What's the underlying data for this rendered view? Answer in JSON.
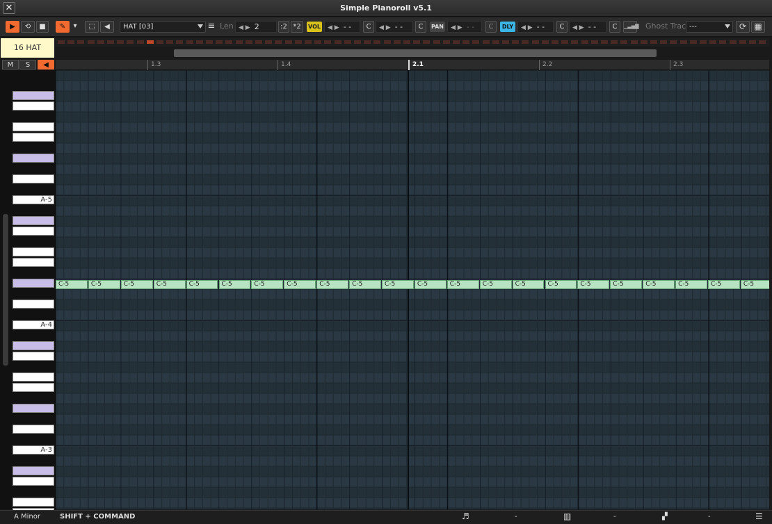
{
  "window": {
    "title": "Simple Pianoroll v5.1",
    "close_icon": "✕"
  },
  "toolbar": {
    "play_icon": "▶",
    "loop_icon": "⟲",
    "stop_icon": "■",
    "pencil_icon": "✎",
    "pencil_menu_icon": "▾",
    "select_icon": "⬚",
    "speaker_icon": "◀",
    "pattern_select": "HAT [03]",
    "menu_icon": "≡",
    "len_label": "Len",
    "len_arrows": "◀ ▶",
    "len_value": "2",
    "div2": ":2",
    "mul2": "*2",
    "vol_badge": "VOL",
    "vol_arrows": "◀ ▶",
    "vol_value": "- -",
    "c_label": "C",
    "pan_arrows": "◀ ▶",
    "pan_value": "- -",
    "pan_badge": "PAN",
    "pan2_arrows": "◀ ▶",
    "pan2_value": "- -",
    "dly_badge": "DLY",
    "dly_arrows": "◀ ▶",
    "dly_value": "- -",
    "dly2_arrows": "◀ ▶",
    "dly2_value": "- -",
    "bars_icon": "▁▃▅▇",
    "ghost_label": "Ghost Track",
    "ghost_select": "---",
    "refresh_icon": "⟳",
    "grid_icon": "▦",
    "colors": {
      "accent": "#f26a2f",
      "vol": "#d9c21a",
      "dly": "#3ab5e6"
    }
  },
  "track": {
    "name": "16 HAT",
    "mute": "M",
    "solo": "S",
    "speaker_icon": "◀"
  },
  "ruler": {
    "marks": [
      "1.3",
      "1.4",
      "2.1",
      "2.2",
      "2.3"
    ],
    "current": "2.1"
  },
  "keyboard": {
    "labels": [
      "A-5",
      "A-4",
      "A-3"
    ]
  },
  "notes": {
    "label": "C-5",
    "count": 22
  },
  "status": {
    "scale": "A Minor",
    "hint": "SHIFT + COMMAND",
    "note_icon": "♬",
    "note_value": "-",
    "piano_icon": "▥",
    "piano_value": "-",
    "snap_icon": "▞",
    "snap_value": "-",
    "menu_icon": "☰"
  }
}
